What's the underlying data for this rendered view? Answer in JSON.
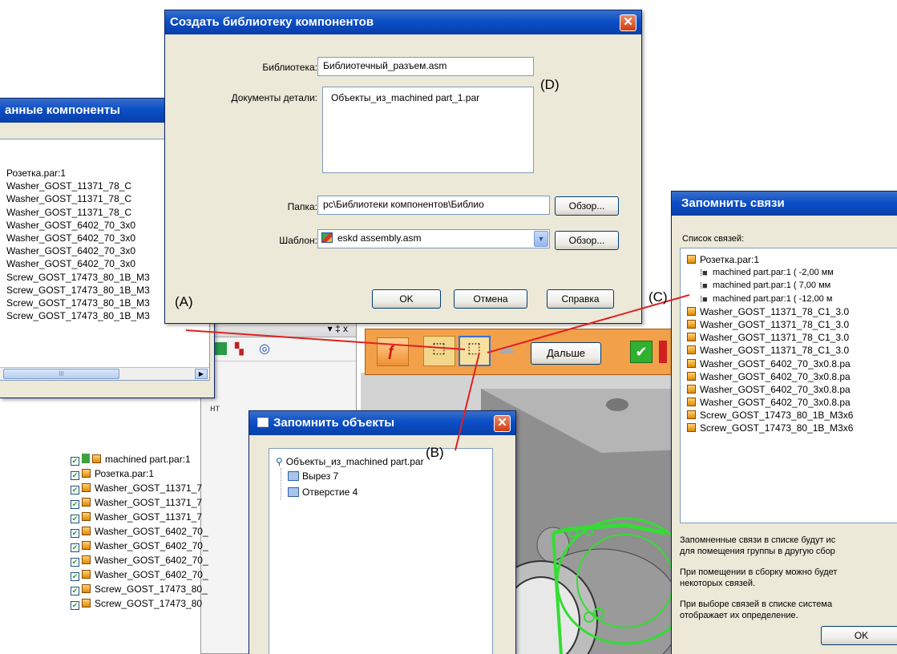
{
  "library_dialog": {
    "title": "Создать библиотеку компонентов",
    "library_label": "Библиотека:",
    "library_value": "Библиотечный_разъем.asm",
    "parts_label": "Документы детали:",
    "parts_value": "Объекты_из_machined part_1.par",
    "folder_label": "Папка:",
    "folder_value": "pc\\Библиотеки компонентов\\Библио",
    "template_label": "Шаблон:",
    "template_value": "eskd assembly.asm",
    "browse1": "Обзор...",
    "browse2": "Обзор...",
    "ok": "OK",
    "cancel": "Отмена",
    "help": "Справка"
  },
  "components_window": {
    "title": "анные компоненты",
    "items": [
      "Розетка.par:1",
      "Washer_GOST_11371_78_C",
      "Washer_GOST_11371_78_C",
      "Washer_GOST_11371_78_C",
      "Washer_GOST_6402_70_3x0",
      "Washer_GOST_6402_70_3x0",
      "Washer_GOST_6402_70_3x0",
      "Washer_GOST_6402_70_3x0",
      "Screw_GOST_17473_80_1B_M3",
      "Screw_GOST_17473_80_1B_M3",
      "Screw_GOST_17473_80_1B_M3",
      "Screw_GOST_17473_80_1B_M3"
    ],
    "scroll_label": "III"
  },
  "toolbar": {
    "next_label": "Дальше",
    "pin_label": "▾ ‡ x"
  },
  "tree": {
    "partial_text": "нт",
    "items": [
      "machined part.par:1",
      "Розетка.par:1",
      "Washer_GOST_11371_7",
      "Washer_GOST_11371_7",
      "Washer_GOST_11371_7",
      "Washer_GOST_6402_70_",
      "Washer_GOST_6402_70_",
      "Washer_GOST_6402_70_",
      "Washer_GOST_6402_70_",
      "Screw_GOST_17473_80_",
      "Screw_GOST_17473_80"
    ]
  },
  "objects_dialog": {
    "title": "Запомнить объекты",
    "root": "Объекты_из_machined part.par",
    "children": [
      "Вырез 7",
      "Отверстие 4"
    ]
  },
  "relations_dialog": {
    "title": "Запомнить связи",
    "list_label": "Список связей:",
    "root": "Розетка.par:1",
    "relations": [
      "machined part.par:1   ( -2,00 мм",
      "machined part.par:1   ( 7,00 мм",
      "machined part.par:1   ( -12,00 м"
    ],
    "parts": [
      "Washer_GOST_11371_78_C1_3.0",
      "Washer_GOST_11371_78_C1_3.0",
      "Washer_GOST_11371_78_C1_3.0",
      "Washer_GOST_11371_78_C1_3.0",
      "Washer_GOST_6402_70_3x0.8.pa",
      "Washer_GOST_6402_70_3x0.8.pa",
      "Washer_GOST_6402_70_3x0.8.pa",
      "Washer_GOST_6402_70_3x0.8.pa",
      "Screw_GOST_17473_80_1B_M3x6",
      "Screw_GOST_17473_80_1B_M3x6"
    ],
    "text1a": "Запомненные связи в списке будут ис",
    "text1b": "для помещения группы в другую сбор",
    "text2a": "При помещении в сборку можно будет",
    "text2b": "некоторых связей.",
    "text3a": "При выборе связей в списке система",
    "text3b": "отображает их определение.",
    "ok": "OK"
  },
  "callouts": {
    "a": "(A)",
    "b": "(B)",
    "c": "(C)",
    "d": "(D)"
  }
}
